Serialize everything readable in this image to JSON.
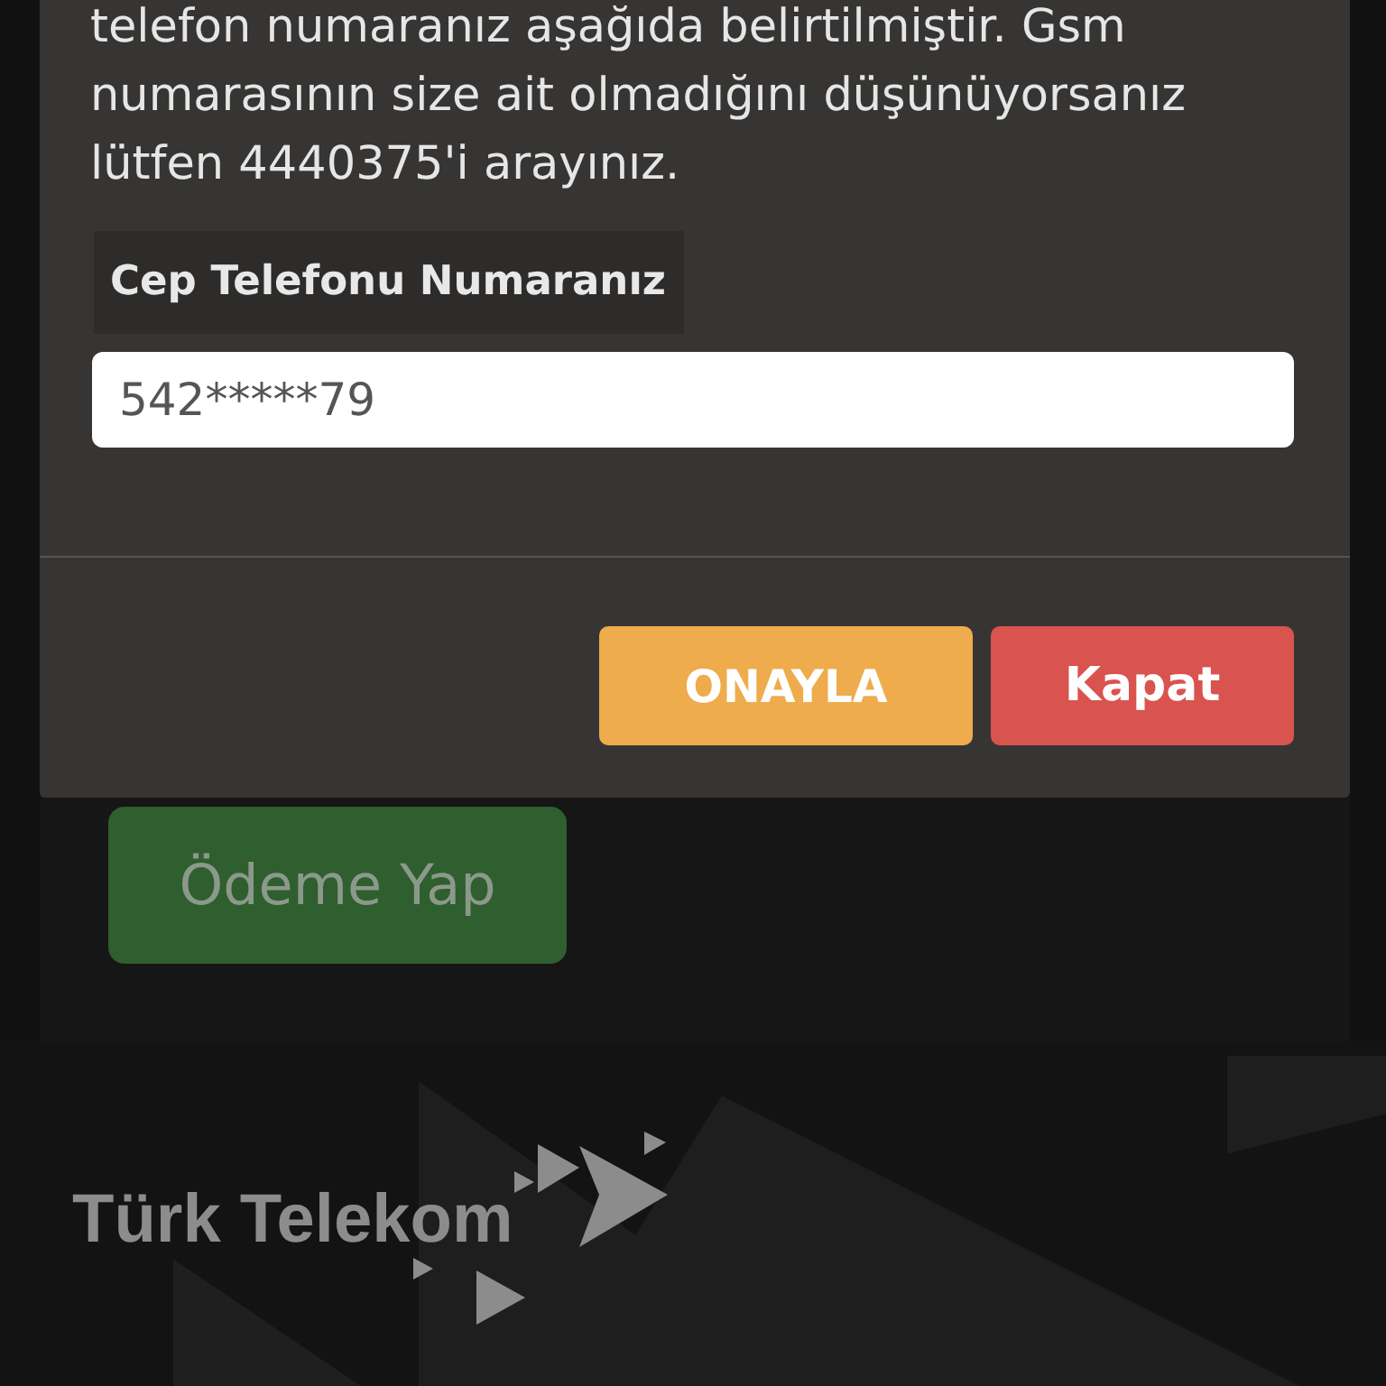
{
  "dialog": {
    "message": "telefon numaranız aşağıda belirtilmiştir. Gsm numarasının size ait olmadığını düşünüyorsanız lütfen 4440375'i arayınız.",
    "field_label": "Cep Telefonu Numaranız",
    "phone_field": {
      "value": "542*****79"
    },
    "buttons": [
      {
        "label": "ONAYLA",
        "kind": "confirm"
      },
      {
        "label": "Kapat",
        "kind": "close"
      }
    ]
  },
  "page": {
    "pay_button": {
      "label": "Ödeme Yap"
    }
  },
  "footer": {
    "logo_text": "Türk Telekom"
  }
}
